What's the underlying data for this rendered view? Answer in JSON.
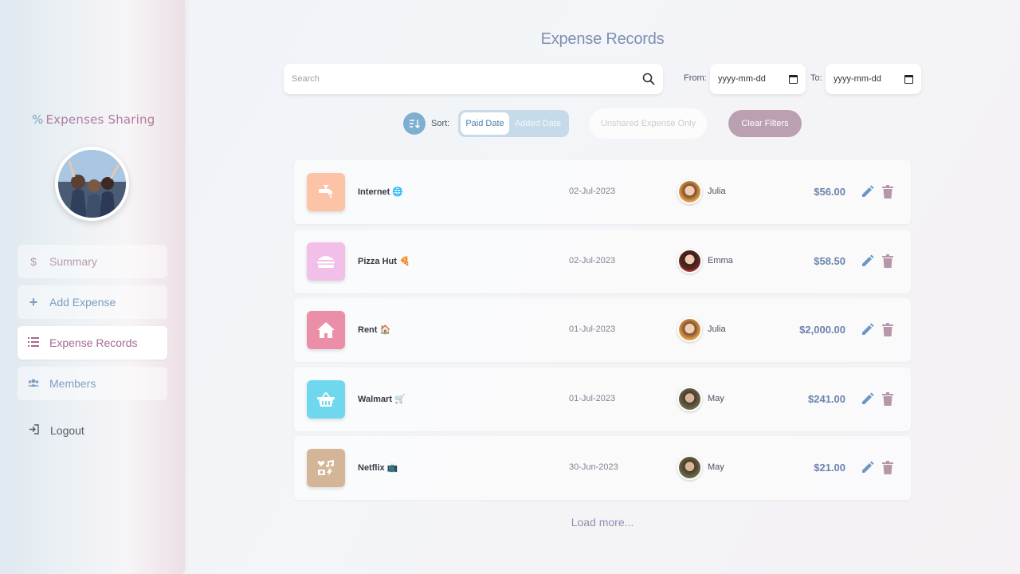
{
  "app": {
    "brand_symbol": "%",
    "brand_name": "Expenses Sharing"
  },
  "sidebar": {
    "items": [
      {
        "label": "Summary",
        "icon": "dollar-icon"
      },
      {
        "label": "Add Expense",
        "icon": "plus-icon"
      },
      {
        "label": "Expense Records",
        "icon": "list-icon",
        "active": true
      },
      {
        "label": "Members",
        "icon": "users-icon"
      }
    ],
    "logout_label": "Logout"
  },
  "main": {
    "title": "Expense Records",
    "search": {
      "placeholder": "Search",
      "value": ""
    },
    "from_label": "From:",
    "from_value": "yyyy-mm-dd",
    "to_label": "To:",
    "to_value": "yyyy-mm-dd",
    "sort_label": "Sort:",
    "sort_options": [
      "Paid Date",
      "Added Date"
    ],
    "sort_selected": "Paid Date",
    "unshared_label": "Unshared Expense Only",
    "clear_label": "Clear Filters",
    "load_more": "Load more..."
  },
  "records": [
    {
      "name": "Internet",
      "emoji": "🌐",
      "date": "02-Jul-2023",
      "payer": "Julia",
      "amount": "$56.00",
      "category_icon": "faucet-icon",
      "color": "#fcc3a6"
    },
    {
      "name": "Pizza Hut",
      "emoji": "🍕",
      "date": "02-Jul-2023",
      "payer": "Emma",
      "amount": "$58.50",
      "category_icon": "burger-icon",
      "color": "#f1bfe7"
    },
    {
      "name": "Rent",
      "emoji": "🏠",
      "date": "01-Jul-2023",
      "payer": "Julia",
      "amount": "$2,000.00",
      "category_icon": "house-icon",
      "color": "#eb8fa8"
    },
    {
      "name": "Walmart",
      "emoji": "🛒",
      "date": "01-Jul-2023",
      "payer": "May",
      "amount": "$241.00",
      "category_icon": "basket-icon",
      "color": "#6fd8ee"
    },
    {
      "name": "Netflix",
      "emoji": "📺",
      "date": "30-Jun-2023",
      "payer": "May",
      "amount": "$21.00",
      "category_icon": "entertainment-icon",
      "color": "#d5b598"
    }
  ]
}
